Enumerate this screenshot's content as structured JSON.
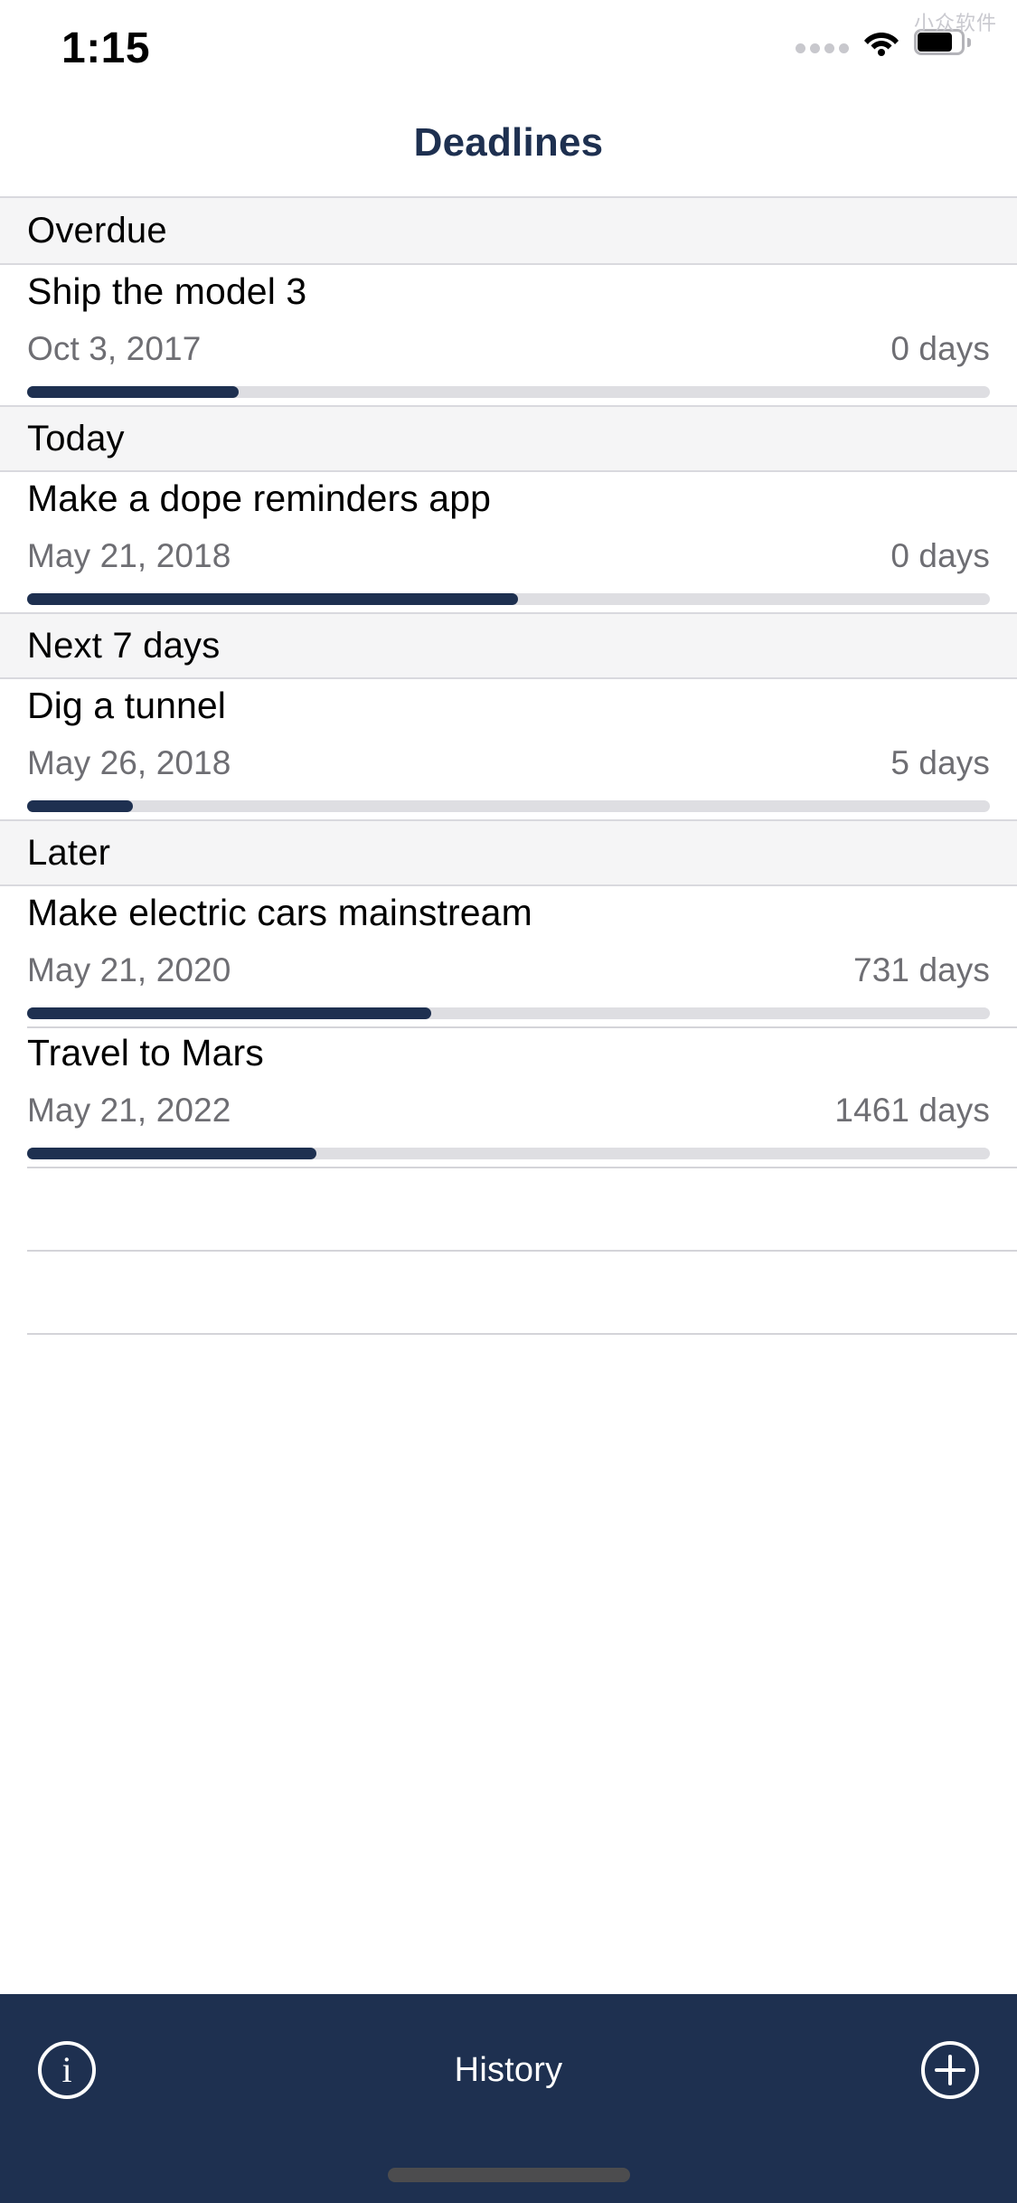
{
  "watermark": "小众软件",
  "status_bar": {
    "time": "1:15",
    "cellular_icon": "cellular-dots-icon",
    "wifi_icon": "wifi-icon",
    "battery_icon": "battery-icon"
  },
  "nav": {
    "title": "Deadlines",
    "title_color": "#1e3050"
  },
  "colors": {
    "accent": "#1e3050",
    "track": "#dedee2",
    "section_bg": "#f5f5f6",
    "secondary_text": "#6e6e73"
  },
  "sections": [
    {
      "title": "Overdue",
      "items": [
        {
          "title": "Ship the model 3",
          "date": "Oct 3, 2017",
          "days": "0 days",
          "progress": 22
        }
      ]
    },
    {
      "title": "Today",
      "items": [
        {
          "title": "Make a dope reminders app",
          "date": "May 21, 2018",
          "days": "0 days",
          "progress": 51
        }
      ]
    },
    {
      "title": "Next 7 days",
      "items": [
        {
          "title": "Dig a tunnel",
          "date": "May 26, 2018",
          "days": "5 days",
          "progress": 11
        }
      ]
    },
    {
      "title": "Later",
      "items": [
        {
          "title": "Make electric cars mainstream",
          "date": "May 21, 2020",
          "days": "731 days",
          "progress": 42
        },
        {
          "title": "Travel to Mars",
          "date": "May 21, 2022",
          "days": "1461 days",
          "progress": 30
        }
      ]
    }
  ],
  "toolbar": {
    "info_icon": "info-icon",
    "info_glyph": "i",
    "history_label": "History",
    "add_icon": "plus-circle-icon"
  }
}
